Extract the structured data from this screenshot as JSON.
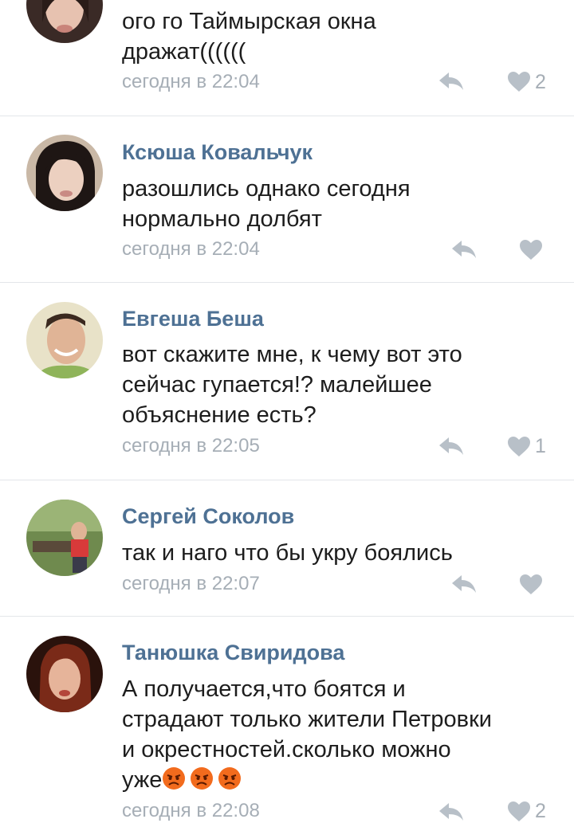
{
  "comments": [
    {
      "author": "",
      "lines": [
        "ого го Таймырская окна",
        "дражат(((((("
      ],
      "time": "сегодня в 22:04",
      "likes": "2"
    },
    {
      "author": "Ксюша Ковальчук",
      "lines": [
        "разошлись однако сегодня",
        "нормально долбят"
      ],
      "time": "сегодня в 22:04",
      "likes": ""
    },
    {
      "author": "Евгеша Беша",
      "lines": [
        "вот скажите мне, к чему вот это",
        "сейчас гупается!? малейшее",
        "объяснение есть?"
      ],
      "time": "сегодня в 22:05",
      "likes": "1"
    },
    {
      "author": "Сергей Соколов",
      "lines": [
        "так и наго что бы укру боялись"
      ],
      "time": "сегодня в 22:07",
      "likes": ""
    },
    {
      "author": "Танюшка Свиридова",
      "lines": [
        "А получается,что боятся и",
        "страдают только жители Петровки",
        "и окрестностей.сколько можно",
        "уже"
      ],
      "time": "сегодня в 22:08",
      "likes": "2",
      "emoji": [
        "angry-face-icon",
        "angry-face-icon",
        "angry-face-icon"
      ]
    }
  ],
  "colors": {
    "author": "#4e7194",
    "text": "#1d1d1d",
    "meta": "#a6aeb6",
    "icon": "#b8c0c8",
    "divider": "#e3e6ea"
  }
}
